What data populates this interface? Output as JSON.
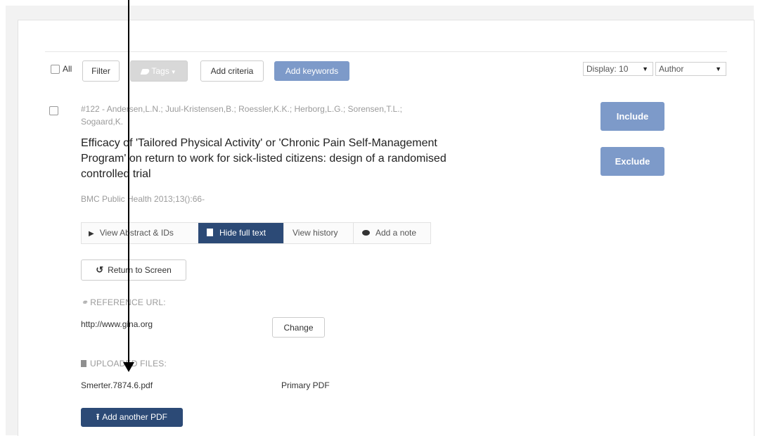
{
  "toolbar": {
    "all_label": "All",
    "filter_label": "Filter",
    "tags_label": "Tags",
    "add_criteria_label": "Add criteria",
    "add_keywords_label": "Add keywords",
    "display_select": "Display: 10",
    "sort_select": "Author"
  },
  "record": {
    "authors_line1": "#122 - Andersen,L.N.; Juul-Kristensen,B.; Roessler,K.K.; Herborg,L.G.; Sorensen,T.L.;",
    "authors_line2": "Sogaard,K.",
    "title_line1": "Efficacy of 'Tailored Physical Activity' or 'Chronic Pain Self-Management",
    "title_line2": "Program' on return to work for sick-listed citizens: design of a randomised",
    "title_line3": "controlled trial",
    "journal": "BMC Public Health 2013;13():66-",
    "include_label": "Include",
    "exclude_label": "Exclude"
  },
  "tabs": {
    "view_abstract": "View Abstract & IDs",
    "hide_full_text": "Hide full text",
    "view_history": "View history",
    "add_note": "Add a note"
  },
  "fulltext": {
    "return_label": "Return to Screen",
    "reference_url_heading": "REFERENCE URL:",
    "reference_url": "http://www.gina.org",
    "change_label": "Change",
    "uploaded_files_heading": "UPLOADED FILES:",
    "file_name": "Smerter.7874.6.pdf",
    "file_type": "Primary PDF",
    "add_pdf_label": "Add another PDF"
  },
  "colors": {
    "accent_blue": "#7d9ac9",
    "navy": "#2c4a76"
  }
}
